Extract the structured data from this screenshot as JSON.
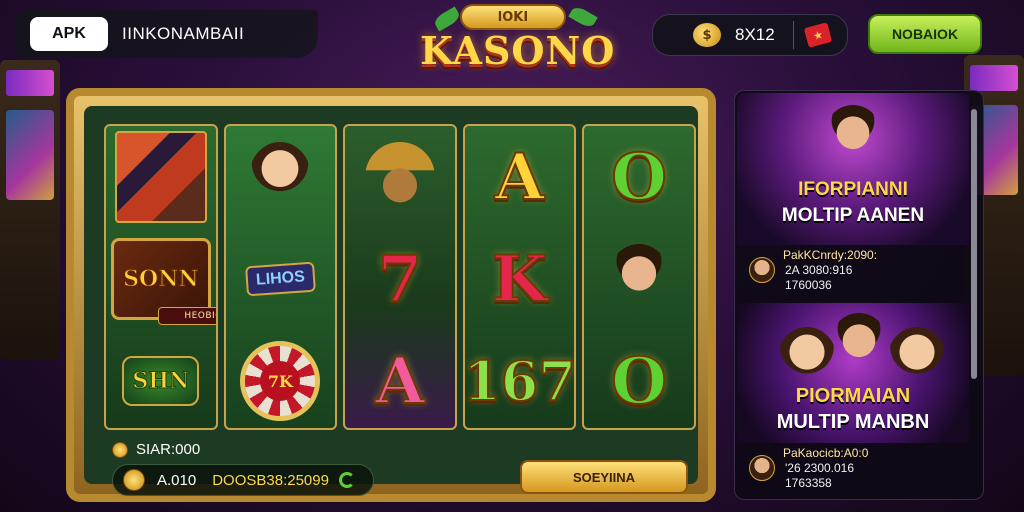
{
  "topbar": {
    "apk_label": "APK",
    "app_name": "IINKONAMBAII"
  },
  "logo": {
    "top_text": "lOKI",
    "main_text": "KASONO"
  },
  "wallet": {
    "coin_icon": "coin-icon",
    "value": "8X12",
    "gift_icon": "gift-icon"
  },
  "top_button": {
    "label": "NOBAIOK"
  },
  "reels": [
    [
      "diagonal-stripes-symbol",
      {
        "tile": "SONN",
        "sub": "HEOBICN"
      },
      {
        "badge": "SHN"
      }
    ],
    [
      "woman-symbol",
      {
        "badge": "LIHOS"
      },
      {
        "wheel": "7K"
      }
    ],
    [
      "cowboy-hat-symbol",
      "7",
      "A"
    ],
    [
      "A",
      "K",
      "167"
    ],
    [
      "O",
      "man-symbol",
      "O"
    ]
  ],
  "machine": {
    "bet_label": "SIAR:000",
    "balance_amount": "A.010",
    "balance_long": "DOOSB38:25099",
    "spin_label": "SOEYIINA"
  },
  "side_cards": [
    {
      "title_line1": "IFORPIANNI",
      "title_line2": "MOLTIP AANEN",
      "info_line1": "PakKCnrdy:2090:",
      "info_line2": "2A 3080:916",
      "info_line3": "1760036"
    },
    {
      "title_line1": "PIORMAIAN",
      "title_line2": "MULTIP MANBN",
      "info_line1": "PaKaocicb:A0:0",
      "info_line2": "'26 2300.016",
      "info_line3": "1763358"
    }
  ],
  "colors": {
    "gold": "#ffd23a",
    "accent_green": "#6fb51a",
    "frame": "#b88a30",
    "reel_bg": "#2d6a2e"
  }
}
